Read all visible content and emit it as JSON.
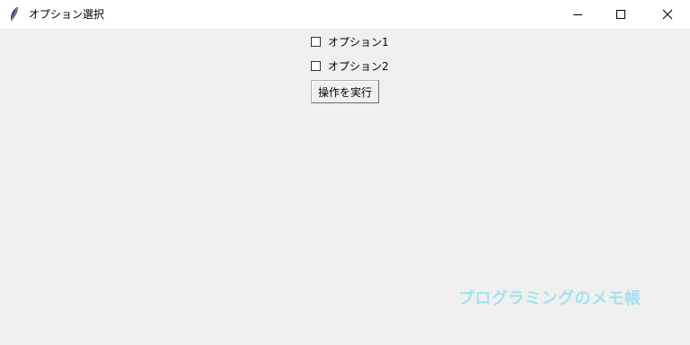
{
  "window": {
    "title": "オプション選択",
    "controls": {
      "minimize_icon": "minimize-icon",
      "maximize_icon": "maximize-icon",
      "close_icon": "close-icon"
    }
  },
  "form": {
    "checkboxes": [
      {
        "label": "オプション1",
        "checked": false
      },
      {
        "label": "オプション2",
        "checked": false
      }
    ],
    "run_button_label": "操作を実行"
  },
  "watermark": {
    "text": "プログラミングのメモ帳",
    "color": "#a6e0ef"
  }
}
